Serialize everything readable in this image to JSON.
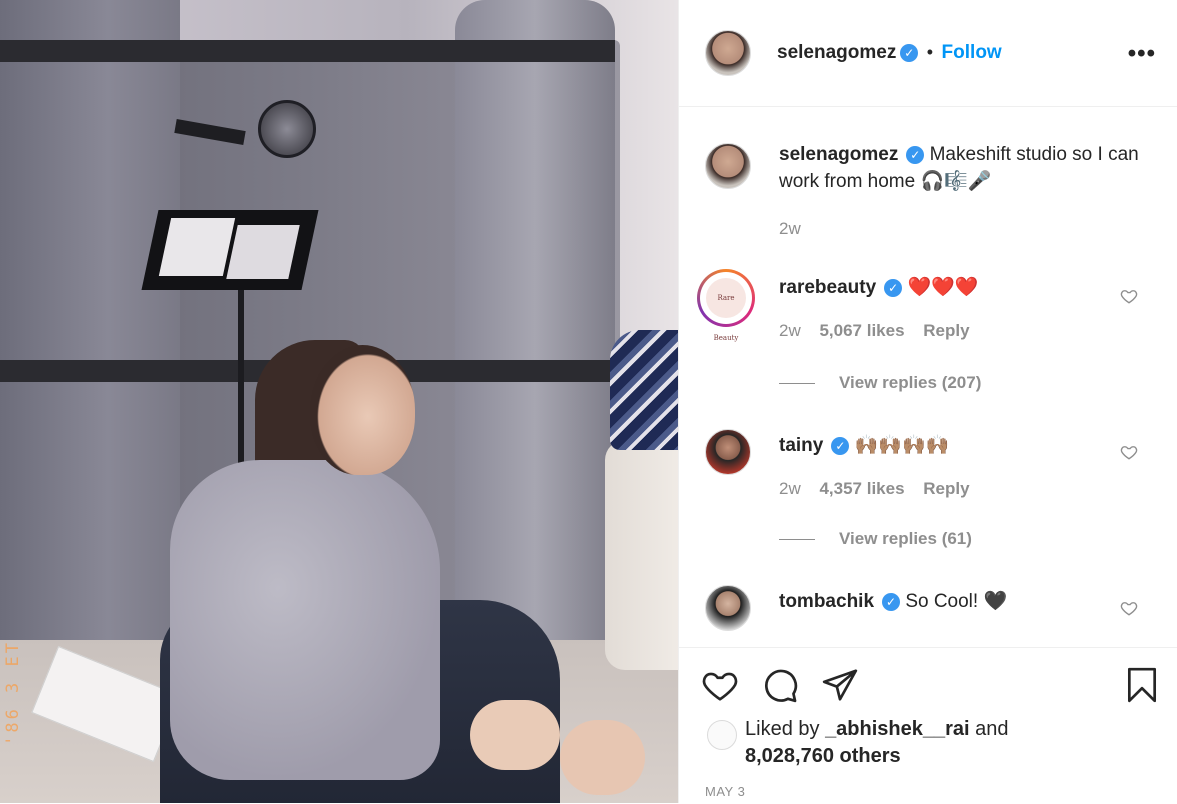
{
  "post": {
    "author": "selenagomez",
    "follow_label": "Follow",
    "separator": "•",
    "more_label": "•••",
    "caption": "Makeshift studio so I can work from home 🎧🎼🎤",
    "caption_age": "2w",
    "photo_date_stamp": "'86 3 ET"
  },
  "comments": [
    {
      "username": "rarebeauty",
      "avatar_text": "Rare Beauty",
      "text": "❤️❤️❤️",
      "age": "2w",
      "likes": "5,067 likes",
      "reply_label": "Reply",
      "view_replies": "View replies (207)"
    },
    {
      "username": "tainy",
      "text": "🙌🏽🙌🏽🙌🏽🙌🏽",
      "age": "2w",
      "likes": "4,357 likes",
      "reply_label": "Reply",
      "view_replies": "View replies (61)"
    },
    {
      "username": "tombachik",
      "text": "So Cool! 🖤"
    }
  ],
  "footer": {
    "liked_prefix": "Liked by",
    "liked_user": "_abhishek__rai",
    "liked_and": "and",
    "liked_others": "8,028,760 others",
    "date": "MAY 3"
  },
  "icons": {
    "like": "heart-icon",
    "comment": "comment-icon",
    "share": "send-icon",
    "save": "bookmark-icon",
    "verified": "verified-badge-icon",
    "more": "more-options-icon"
  },
  "colors": {
    "link_blue": "#0095f6",
    "verified_blue": "#3897f0",
    "muted_text": "#8e8e8e",
    "text": "#262626"
  }
}
